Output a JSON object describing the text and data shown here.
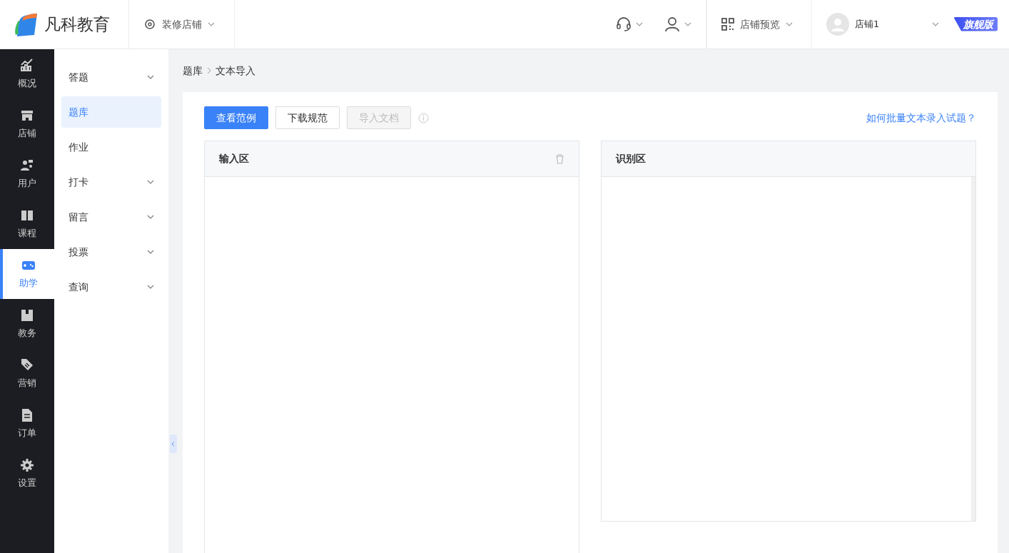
{
  "header": {
    "logo": "凡科教育",
    "decorate": "装修店铺",
    "preview": "店铺预览",
    "shop": "店铺1",
    "edition": "旗舰版"
  },
  "rail": [
    {
      "label": "概况",
      "selected": false
    },
    {
      "label": "店铺",
      "selected": false
    },
    {
      "label": "用户",
      "selected": false
    },
    {
      "label": "课程",
      "selected": false
    },
    {
      "label": "助学",
      "selected": true
    },
    {
      "label": "教务",
      "selected": false
    },
    {
      "label": "营销",
      "selected": false
    },
    {
      "label": "订单",
      "selected": false
    },
    {
      "label": "设置",
      "selected": false
    }
  ],
  "submenu": [
    {
      "label": "答题",
      "expandable": true,
      "selected": false
    },
    {
      "label": "题库",
      "expandable": false,
      "selected": true
    },
    {
      "label": "作业",
      "expandable": false,
      "selected": false
    },
    {
      "label": "打卡",
      "expandable": true,
      "selected": false
    },
    {
      "label": "留言",
      "expandable": true,
      "selected": false
    },
    {
      "label": "投票",
      "expandable": true,
      "selected": false
    },
    {
      "label": "查询",
      "expandable": true,
      "selected": false
    }
  ],
  "breadcrumb": [
    "题库",
    "文本导入"
  ],
  "buttons": [
    {
      "label": "查看范例",
      "kind": "primary",
      "disabled": false
    },
    {
      "label": "下载规范",
      "kind": "default",
      "disabled": false
    },
    {
      "label": "导入文档",
      "kind": "default",
      "disabled": true
    }
  ],
  "help_link": "如何批量文本录入试题？",
  "panels": [
    {
      "title": "输入区",
      "deletable": true
    },
    {
      "title": "识别区",
      "deletable": false
    }
  ]
}
